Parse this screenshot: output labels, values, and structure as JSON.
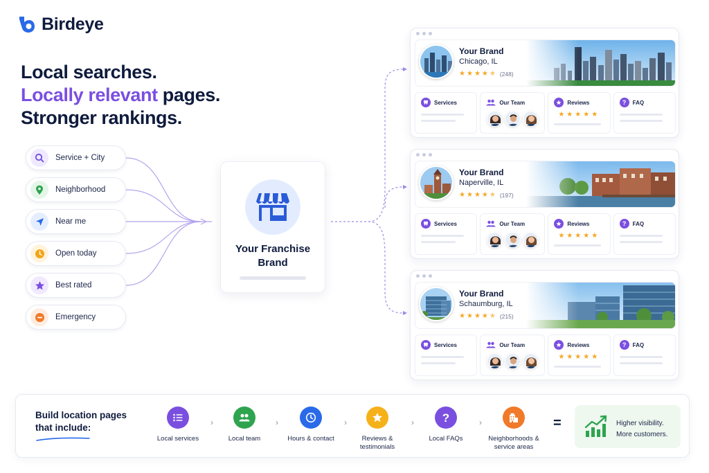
{
  "brand": {
    "name": "Birdeye"
  },
  "headline": {
    "line1": "Local searches.",
    "line2_accent": "Locally relevant",
    "line2_rest": " pages.",
    "line3": "Stronger rankings."
  },
  "searches": [
    {
      "label": "Service + City",
      "icon": "search-icon",
      "color": "#6d4ee0",
      "bg": "#efe9ff"
    },
    {
      "label": "Neighborhood",
      "icon": "map-pin-icon",
      "color": "#2fa44f",
      "bg": "#e5f6e9"
    },
    {
      "label": "Near me",
      "icon": "navigation-arrow-icon",
      "color": "#2a6ae8",
      "bg": "#e5eeff"
    },
    {
      "label": "Open today",
      "icon": "clock-icon",
      "color": "#f2a51a",
      "bg": "#fff3dc"
    },
    {
      "label": "Best rated",
      "icon": "star-icon",
      "color": "#7a4fe0",
      "bg": "#f0e9ff"
    },
    {
      "label": "Emergency",
      "icon": "alert-icon",
      "color": "#f07a2a",
      "bg": "#ffece0"
    }
  ],
  "franchise": {
    "title": "Your Franchise Brand",
    "icon": "storefront-icon"
  },
  "locations": [
    {
      "brand": "Your Brand",
      "city": "Chicago, IL",
      "rating": 4.5,
      "count": "(248)",
      "scene": "skyline"
    },
    {
      "brand": "Your Brand",
      "city": "Naperville, IL",
      "rating": 4.5,
      "count": "(197)",
      "scene": "riverwalk"
    },
    {
      "brand": "Your Brand",
      "city": "Schaumburg, IL",
      "rating": 4.5,
      "count": "(215)",
      "scene": "office"
    }
  ],
  "tiles": {
    "services": "Services",
    "team": "Our Team",
    "reviews": "Reviews",
    "faq": "FAQ"
  },
  "bottom": {
    "title": "Build location pages that include:",
    "steps": [
      {
        "label": "Local services",
        "icon": "list-icon",
        "color": "#7a4fe0"
      },
      {
        "label": "Local team",
        "icon": "team-icon",
        "color": "#2fa44f"
      },
      {
        "label": "Hours & contact",
        "icon": "clock-icon",
        "color": "#2a6ae8"
      },
      {
        "label": "Reviews & testimonials",
        "icon": "star-icon",
        "color": "#f5b11a"
      },
      {
        "label": "Local FAQs",
        "icon": "question-icon",
        "color": "#7a4fe0"
      },
      {
        "label": "Neighborhoods & service areas",
        "icon": "building-icon",
        "color": "#f07a2a"
      }
    ],
    "equals": "=",
    "result_line1": "Higher visibility.",
    "result_line2": "More customers."
  }
}
